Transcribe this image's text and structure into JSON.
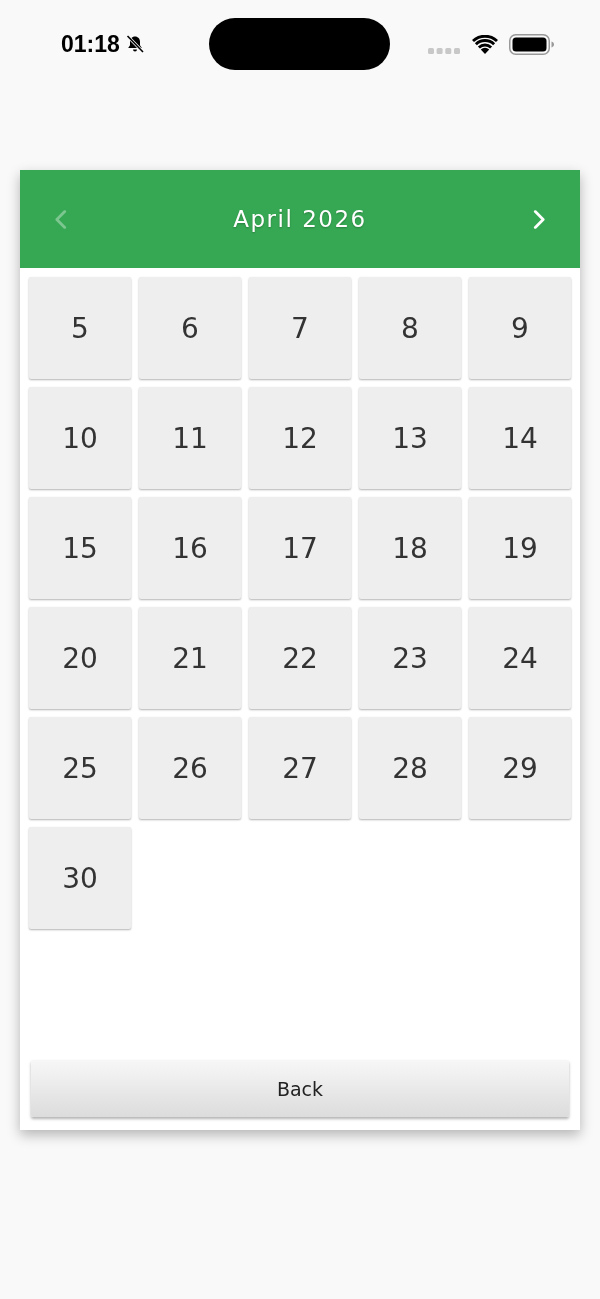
{
  "status_bar": {
    "time": "01:18"
  },
  "calendar": {
    "title": "April 2026",
    "prev": {
      "disabled": true
    },
    "next": {
      "disabled": false
    },
    "days": [
      "5",
      "6",
      "7",
      "8",
      "9",
      "10",
      "11",
      "12",
      "13",
      "14",
      "15",
      "16",
      "17",
      "18",
      "19",
      "20",
      "21",
      "22",
      "23",
      "24",
      "25",
      "26",
      "27",
      "28",
      "29",
      "30"
    ]
  },
  "back_button": {
    "label": "Back"
  }
}
